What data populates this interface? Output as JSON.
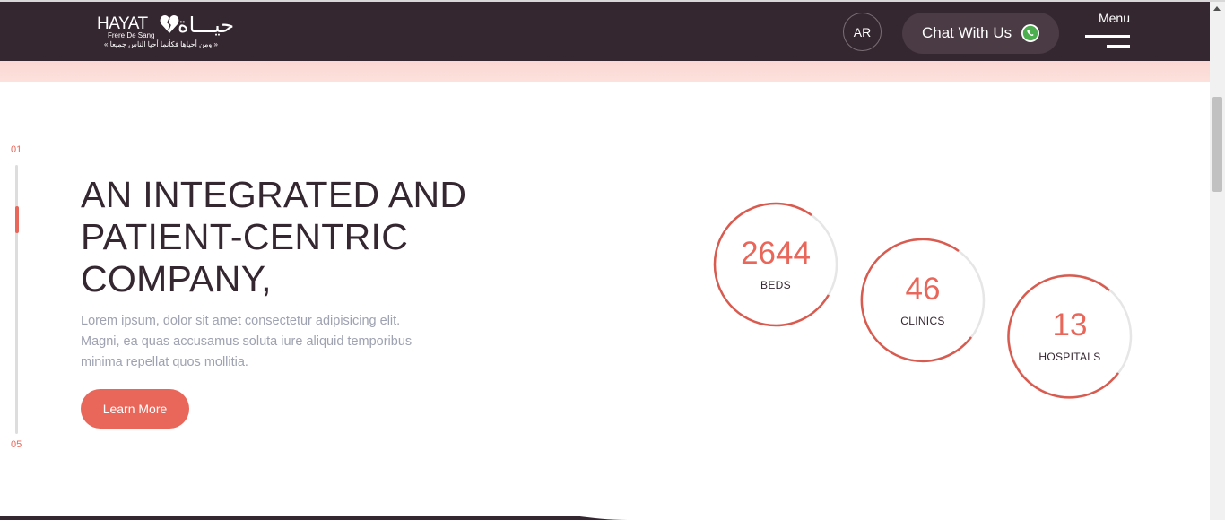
{
  "header": {
    "logo": {
      "name": "HAYAT",
      "subtitle": "Frere De Sang",
      "tagline": "« ومن أحياها فكأنما أحيا الناس جميعا »",
      "arabic_name": "حيـــاة"
    },
    "lang_button": "AR",
    "chat_button": "Chat With Us",
    "menu_label": "Menu"
  },
  "slider": {
    "start": "01",
    "end": "05",
    "position": 0.16
  },
  "hero": {
    "title": "AN INTEGRATED AND PATIENT-CENTRIC COMPANY,",
    "text": "Lorem ipsum, dolor sit amet consectetur adipisicing elit. Magni, ea quas accusamus soluta iure aliquid temporibus minima repellat quos mollitia.",
    "cta": "Learn More"
  },
  "stats": [
    {
      "value": "2644",
      "label": "BEDS"
    },
    {
      "value": "46",
      "label": "CLINICS"
    },
    {
      "value": "13",
      "label": "HOSPITALS"
    }
  ],
  "colors": {
    "header_bg": "#352730",
    "accent": "#e8675a",
    "pink_band": "#fbd7d2",
    "body_text": "#9ea2b1",
    "chat_bg": "#4a3b44"
  },
  "icons": [
    "heart-logo-icon",
    "whatsapp-icon",
    "hamburger-menu-icon"
  ]
}
